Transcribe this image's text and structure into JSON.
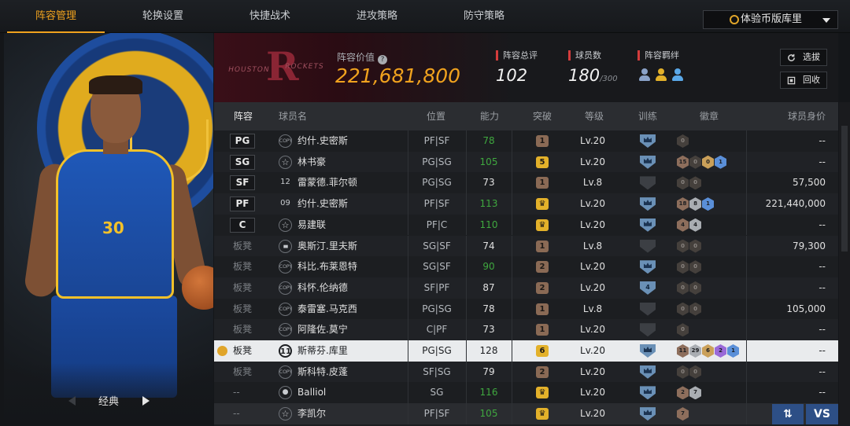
{
  "nav": {
    "tabs": [
      {
        "label": "阵容管理",
        "active": true
      },
      {
        "label": "轮换设置",
        "active": false
      },
      {
        "label": "快捷战术",
        "active": false
      },
      {
        "label": "进攻策略",
        "active": false
      },
      {
        "label": "防守策略",
        "active": false
      }
    ],
    "selected_player": "体验币版库里"
  },
  "portrait": {
    "style_label": "经典",
    "jersey_number": "30"
  },
  "team": {
    "city": "HOUSTON",
    "name": "ROCKETS",
    "logo_letter": "R",
    "accent": "#8a2534"
  },
  "summary": {
    "value_label": "阵容价值",
    "value": "221,681,800",
    "overall_label": "阵容总评",
    "overall": "102",
    "count_label": "球员数",
    "count": "180",
    "count_max": "/300",
    "bonds_label": "阵容羁绊",
    "bonds": [
      {
        "icon": "bond-group-icon",
        "color": "#8aa2c8"
      },
      {
        "icon": "bond-group-icon",
        "color": "#e3b12a"
      },
      {
        "icon": "bond-group-icon",
        "color": "#5aa8e8"
      }
    ],
    "pick_button": "选拔",
    "recycle_button": "回收"
  },
  "table": {
    "headers": {
      "lineup": "阵容",
      "name": "球员名",
      "position": "位置",
      "rating": "能力",
      "breakthrough": "突破",
      "level": "等级",
      "training": "训练",
      "emblems": "徽章",
      "value": "球员身价"
    },
    "rows": [
      {
        "slot": "PG",
        "bench": false,
        "badge": "COPY",
        "name": "约什.史密斯",
        "pos": "PF|SF",
        "rating": "78",
        "green": true,
        "brk": "1",
        "brk_type": "br",
        "level": "Lv.20",
        "train": true,
        "train_label": "",
        "emblems": [
          {
            "c": "dk",
            "t": "0"
          }
        ],
        "value": "--"
      },
      {
        "slot": "SG",
        "bench": false,
        "badge": "star",
        "name": "林书豪",
        "pos": "PG|SG",
        "rating": "105",
        "green": true,
        "brk": "5",
        "brk_type": "gd",
        "level": "Lv.20",
        "train": true,
        "train_label": "",
        "emblems": [
          {
            "c": "br",
            "t": "15"
          },
          {
            "c": "dk",
            "t": "0"
          },
          {
            "c": "go",
            "t": "0"
          },
          {
            "c": "bl",
            "t": "1"
          }
        ],
        "value": "--"
      },
      {
        "slot": "SF",
        "bench": false,
        "badge": "12",
        "name": "雷蒙德.菲尔顿",
        "pos": "PG|SG",
        "rating": "73",
        "green": false,
        "brk": "1",
        "brk_type": "br",
        "level": "Lv.8",
        "train": false,
        "train_label": "",
        "emblems": [
          {
            "c": "dk",
            "t": "0"
          },
          {
            "c": "dk",
            "t": "0"
          }
        ],
        "value": "57,500"
      },
      {
        "slot": "PF",
        "bench": false,
        "badge": "09",
        "name": "约什.史密斯",
        "pos": "PF|SF",
        "rating": "113",
        "green": true,
        "brk": "crown",
        "brk_type": "gd",
        "level": "Lv.20",
        "train": true,
        "train_label": "",
        "emblems": [
          {
            "c": "br",
            "t": "18"
          },
          {
            "c": "si",
            "t": "8"
          },
          {
            "c": "bl",
            "t": "1"
          }
        ],
        "value": "221,440,000"
      },
      {
        "slot": "C",
        "bench": false,
        "badge": "star",
        "name": "易建联",
        "pos": "PF|C",
        "rating": "110",
        "green": true,
        "brk": "crown",
        "brk_type": "gd",
        "level": "Lv.20",
        "train": true,
        "train_label": "",
        "emblems": [
          {
            "c": "br",
            "t": "4"
          },
          {
            "c": "si",
            "t": "4"
          }
        ],
        "value": "--"
      },
      {
        "slot": "板凳",
        "bench": true,
        "badge": "bars",
        "name": "奥斯汀.里夫斯",
        "pos": "SG|SF",
        "rating": "74",
        "green": false,
        "brk": "1",
        "brk_type": "br",
        "level": "Lv.8",
        "train": false,
        "train_label": "",
        "emblems": [
          {
            "c": "dk",
            "t": "0"
          },
          {
            "c": "dk",
            "t": "0"
          }
        ],
        "value": "79,300"
      },
      {
        "slot": "板凳",
        "bench": true,
        "badge": "COPY",
        "name": "科比.布莱恩特",
        "pos": "SG|SF",
        "rating": "90",
        "green": true,
        "brk": "2",
        "brk_type": "br",
        "level": "Lv.20",
        "train": true,
        "train_label": "",
        "emblems": [
          {
            "c": "dk",
            "t": "0"
          },
          {
            "c": "dk",
            "t": "0"
          }
        ],
        "value": "--"
      },
      {
        "slot": "板凳",
        "bench": true,
        "badge": "COPY",
        "name": "科怀.伦纳德",
        "pos": "SF|PF",
        "rating": "87",
        "green": false,
        "brk": "2",
        "brk_type": "br",
        "level": "Lv.20",
        "train": true,
        "train_label": "4",
        "emblems": [
          {
            "c": "dk",
            "t": "0"
          },
          {
            "c": "dk",
            "t": "0"
          }
        ],
        "value": "--"
      },
      {
        "slot": "板凳",
        "bench": true,
        "badge": "COPY",
        "name": "泰雷塞.马克西",
        "pos": "PG|SG",
        "rating": "78",
        "green": false,
        "brk": "1",
        "brk_type": "br",
        "level": "Lv.8",
        "train": false,
        "train_label": "",
        "emblems": [
          {
            "c": "dk",
            "t": "0"
          },
          {
            "c": "dk",
            "t": "0"
          }
        ],
        "value": "105,000"
      },
      {
        "slot": "板凳",
        "bench": true,
        "badge": "COPY",
        "name": "阿隆佐.莫宁",
        "pos": "C|PF",
        "rating": "73",
        "green": false,
        "brk": "1",
        "brk_type": "br",
        "level": "Lv.20",
        "train": false,
        "train_label": "",
        "emblems": [
          {
            "c": "dk",
            "t": "0"
          }
        ],
        "value": "--"
      },
      {
        "slot": "板凳",
        "bench": true,
        "selected": true,
        "badge": "big",
        "badge_text": "11",
        "name": "斯蒂芬.库里",
        "pos": "PG|SG",
        "rating": "128",
        "green": false,
        "brk": "6",
        "brk_type": "gd",
        "level": "Lv.20",
        "train": true,
        "train_label": "",
        "emblems": [
          {
            "c": "br",
            "t": "11"
          },
          {
            "c": "si",
            "t": "29"
          },
          {
            "c": "go",
            "t": "6"
          },
          {
            "c": "pu",
            "t": "2"
          },
          {
            "c": "bl",
            "t": "1"
          }
        ],
        "value": "--"
      },
      {
        "slot": "板凳",
        "bench": true,
        "badge": "COPY",
        "name": "斯科特.皮蓬",
        "pos": "SF|SG",
        "rating": "79",
        "green": false,
        "brk": "2",
        "brk_type": "br",
        "level": "Lv.20",
        "train": true,
        "train_label": "",
        "emblems": [
          {
            "c": "dk",
            "t": "0"
          },
          {
            "c": "dk",
            "t": "0"
          }
        ],
        "value": "--"
      },
      {
        "slot": "--",
        "bench": true,
        "badge": "person",
        "name": "Balliol",
        "pos": "SG",
        "rating": "116",
        "green": true,
        "brk": "crown",
        "brk_type": "gd",
        "level": "Lv.20",
        "train": true,
        "train_label": "",
        "emblems": [
          {
            "c": "br",
            "t": "2"
          },
          {
            "c": "si",
            "t": "7"
          }
        ],
        "value": "--"
      },
      {
        "slot": "--",
        "bench": true,
        "dim": true,
        "badge": "star",
        "name": "李凯尔",
        "pos": "PF|SF",
        "rating": "105",
        "green": true,
        "brk": "crown",
        "brk_type": "gd",
        "level": "Lv.20",
        "train": true,
        "train_label": "",
        "emblems": [
          {
            "c": "br",
            "t": "7"
          }
        ],
        "value": ""
      }
    ]
  },
  "actions": {
    "swap": "⇅",
    "vs": "VS"
  }
}
